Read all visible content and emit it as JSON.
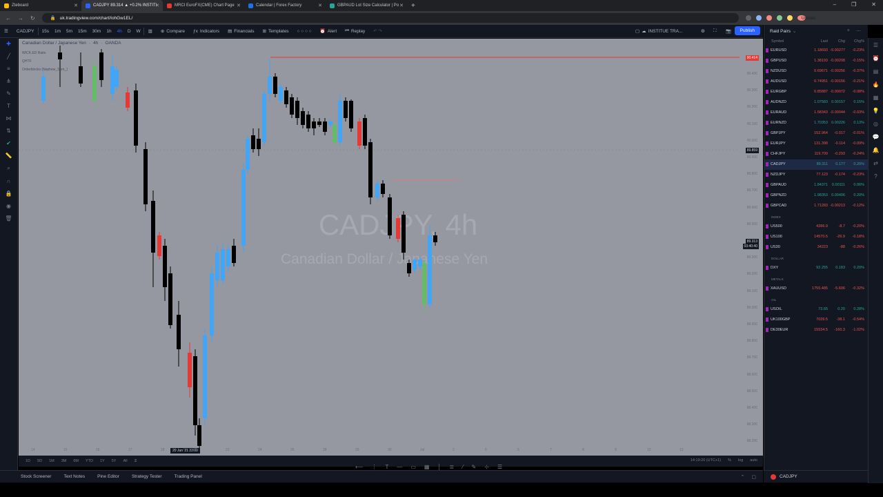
{
  "browser": {
    "tabs": [
      {
        "title": "Zteboard",
        "color": "#fbbc04"
      },
      {
        "title": "CADJPY 89.314 ▲ +0.2% INSTITI",
        "color": "#2962ff"
      },
      {
        "title": "MRCI EuroFX(CME) Chart Page",
        "color": "#e53935"
      },
      {
        "title": "Calendar | Forex Factory",
        "color": "#1a73e8"
      },
      {
        "title": "GBPAUD Lot Size Calculator | Po",
        "color": "#26a69a"
      }
    ],
    "url": "uk.tradingview.com/chart/IohGw1EL/",
    "update_label": "Update"
  },
  "toolbar": {
    "symbol": "CADJPY",
    "intervals": [
      "15s",
      "1m",
      "5m",
      "15m",
      "30m",
      "1h",
      "4h",
      "D",
      "W"
    ],
    "compare": "Compare",
    "indicators": "Indicators",
    "financials": "Financials",
    "templates": "Templates",
    "alert": "Alert",
    "replay": "Replay",
    "layout_name": "INSTITUE TRA...",
    "publish": "Publish"
  },
  "chart": {
    "legend_title": "Canadian Dollar / Japanese Yen",
    "legend_interval": "4h",
    "legend_source": "OANDA",
    "indicators": [
      "WICK.ED Ratio",
      "QHTF",
      "Orderblocks (Nephew_Sam_)"
    ],
    "watermark_symbol": "CADJPY, 4h",
    "watermark_name": "Canadian Dollar / Japanese Yen",
    "price_top_label": "90.414",
    "price_mid_label": "89.859",
    "price_current_label": "89.313",
    "price_current_time": "03:40:40",
    "price_axis": [
      "90.400",
      "90.300",
      "90.200",
      "90.100",
      "90.000",
      "89.900",
      "89.800",
      "89.700",
      "89.600",
      "89.500",
      "89.400",
      "89.300",
      "89.200",
      "89.100",
      "89.000",
      "88.900",
      "88.800",
      "88.700",
      "88.600",
      "88.500",
      "88.400",
      "88.300",
      "88.200"
    ],
    "time_axis": [
      "14",
      "15",
      "16",
      "17",
      "18",
      "22",
      "23",
      "24",
      "25",
      "28",
      "29",
      "30",
      "Jul",
      "2",
      "5",
      "6",
      "7",
      "8",
      "9",
      "12",
      "13"
    ],
    "time_badge": "20 Jun '21  22:00"
  },
  "rangebar": {
    "ranges": [
      "1D",
      "5D",
      "1M",
      "3M",
      "6M",
      "YTD",
      "1Y",
      "5Y",
      "All"
    ],
    "clock": "14:19:20 (UTC+1)",
    "pct": "%",
    "log": "log",
    "auto": "auto"
  },
  "bottom_panel": [
    "Stock Screener",
    "Text Notes",
    "Pine Editor",
    "Strategy Tester",
    "Trading Panel"
  ],
  "watchlist": {
    "title": "Raid Pairs",
    "columns": {
      "symbol": "Symbol",
      "last": "Last",
      "chg": "Chg",
      "chgp": "Chg%"
    },
    "forex": [
      {
        "sym": "EURUSD",
        "last": "1.18693",
        "chg": "-0.00277",
        "pct": "-0.23%",
        "dir": "dn"
      },
      {
        "sym": "GBPUSD",
        "last": "1.38193",
        "chg": "-0.00208",
        "pct": "-0.15%",
        "dir": "dn"
      },
      {
        "sym": "NZDUSD",
        "last": "0.69671",
        "chg": "-0.00256",
        "pct": "-0.37%",
        "dir": "dn"
      },
      {
        "sym": "AUDUSD",
        "last": "0.74951",
        "chg": "-0.00156",
        "pct": "-0.21%",
        "dir": "dn"
      },
      {
        "sym": "EURGBP",
        "last": "0.85887",
        "chg": "-0.00072",
        "pct": "-0.08%",
        "dir": "dn"
      },
      {
        "sym": "AUDNZD",
        "last": "1.07583",
        "chg": "0.00157",
        "pct": "0.15%",
        "dir": "up"
      },
      {
        "sym": "EURAUD",
        "last": "1.58343",
        "chg": "-0.00044",
        "pct": "-0.03%",
        "dir": "dn"
      },
      {
        "sym": "EURNZD",
        "last": "1.70353",
        "chg": "0.00226",
        "pct": "0.13%",
        "dir": "up"
      },
      {
        "sym": "GBPJPY",
        "last": "152.964",
        "chg": "-0.017",
        "pct": "-0.01%",
        "dir": "dn"
      },
      {
        "sym": "EURJPY",
        "last": "131.398",
        "chg": "-0.114",
        "pct": "-0.09%",
        "dir": "dn"
      },
      {
        "sym": "CHFJPY",
        "last": "119.709",
        "chg": "-0.293",
        "pct": "-0.24%",
        "dir": "dn"
      },
      {
        "sym": "CADJPY",
        "last": "89.311",
        "chg": "0.177",
        "pct": "0.20%",
        "dir": "up",
        "selected": true
      },
      {
        "sym": "NZDJPY",
        "last": "77.123",
        "chg": "-0.174",
        "pct": "-0.23%",
        "dir": "dn"
      },
      {
        "sym": "GBPAUD",
        "last": "1.84371",
        "chg": "0.00111",
        "pct": "0.06%",
        "dir": "up"
      },
      {
        "sym": "GBPNZD",
        "last": "1.98353",
        "chg": "0.00406",
        "pct": "0.20%",
        "dir": "up"
      },
      {
        "sym": "GBPCAD",
        "last": "1.71283",
        "chg": "-0.00213",
        "pct": "-0.12%",
        "dir": "dn"
      }
    ],
    "sections": {
      "index": "INDEX",
      "dollar": "DOLLAR",
      "metals": "METALS",
      "oil": "OIL"
    },
    "index": [
      {
        "sym": "US500",
        "last": "4286.9",
        "chg": "-8.7",
        "pct": "-0.20%",
        "dir": "dn"
      },
      {
        "sym": "US100",
        "last": "14570.5",
        "chg": "-26.9",
        "pct": "-0.18%",
        "dir": "dn"
      },
      {
        "sym": "US30",
        "last": "34223",
        "chg": "-88",
        "pct": "-0.26%",
        "dir": "dn"
      }
    ],
    "dollar": [
      {
        "sym": "DXY",
        "last": "92.255",
        "chg": "0.183",
        "pct": "0.20%",
        "dir": "up"
      }
    ],
    "metals": [
      {
        "sym": "XAUUSD",
        "last": "1755.485",
        "chg": "-5.606",
        "pct": "-0.32%",
        "dir": "dn"
      }
    ],
    "oil": [
      {
        "sym": "USOIL",
        "last": "73.65",
        "chg": "0.20",
        "pct": "0.28%",
        "dir": "up"
      },
      {
        "sym": "UK100GBP",
        "last": "7039.5",
        "chg": "-38.1",
        "pct": "-0.54%",
        "dir": "dn"
      },
      {
        "sym": "DE30EUR",
        "last": "15534.5",
        "chg": "-160.3",
        "pct": "-1.02%",
        "dir": "dn"
      }
    ],
    "bottom_symbol": "CADJPY"
  },
  "colors": {
    "bull": "#42a5f5",
    "bear": "#000000",
    "bull_strong": "#66bb6a",
    "bear_strong": "#e53935",
    "accent": "#2962ff"
  }
}
